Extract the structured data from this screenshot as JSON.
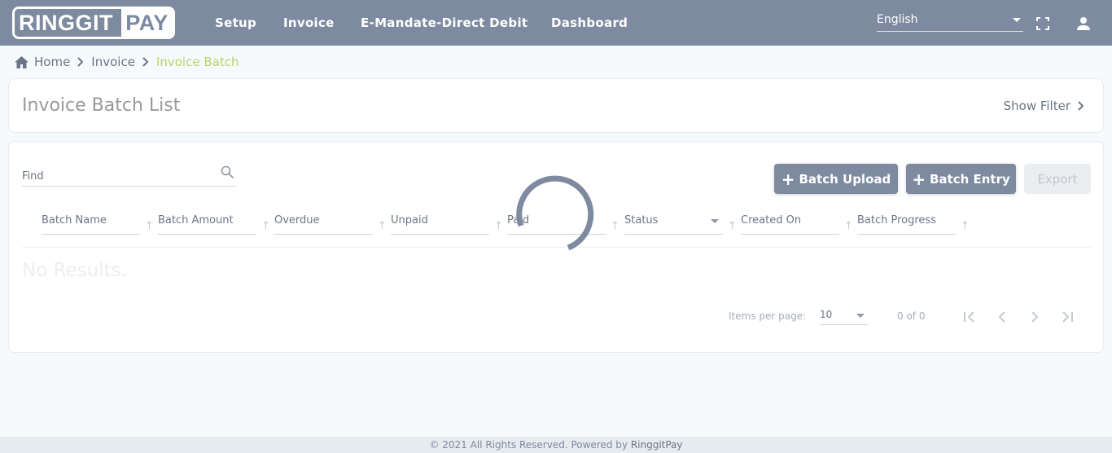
{
  "header": {
    "logo_left": "RINGGIT",
    "logo_right": "PAY",
    "nav": [
      "Setup",
      "Invoice",
      "E-Mandate-Direct Debit",
      "Dashboard"
    ],
    "language": "English",
    "fullscreen_icon": "fullscreen-icon",
    "user_icon": "user-icon"
  },
  "breadcrumb": {
    "home": "Home",
    "parent": "Invoice",
    "current": "Invoice Batch",
    "active_color": "#b6d36f"
  },
  "page": {
    "title": "Invoice Batch List",
    "show_filter": "Show Filter"
  },
  "toolbar": {
    "find_placeholder": "Find",
    "batch_upload": "Batch Upload",
    "batch_entry": "Batch Entry",
    "export": "Export"
  },
  "table": {
    "columns": [
      "Batch Name",
      "Batch Amount",
      "Overdue",
      "Unpaid",
      "Paid",
      "Status",
      "Created On",
      "Batch Progress"
    ],
    "empty_text": "No Results."
  },
  "pagination": {
    "items_per_page_label": "Items per page:",
    "items_per_page": "10",
    "range": "0 of 0"
  },
  "footer": {
    "text": "© 2021 All Rights Reserved. Powered by ",
    "brand": "RinggitPay"
  },
  "colors": {
    "primary": "#7d8a9f",
    "accent": "#b6d36f"
  }
}
